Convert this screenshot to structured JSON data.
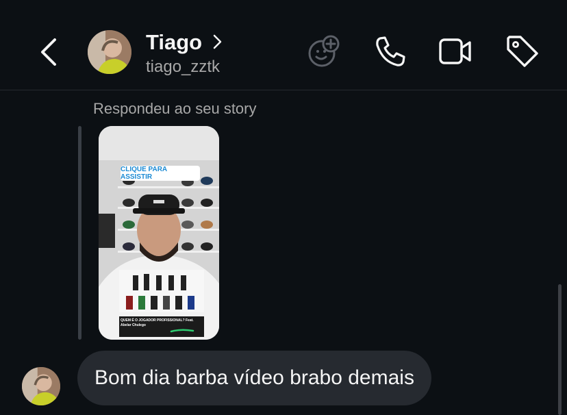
{
  "header": {
    "name": "Tiago",
    "username": "tiago_zztk"
  },
  "icons": {
    "back": "chevron-left-icon",
    "profile_chevron": "chevron-right-icon",
    "effects": "face-plus-icon",
    "call": "phone-icon",
    "video": "video-camera-icon",
    "tag": "tag-icon"
  },
  "thread": {
    "reply_label": "Respondeu ao seu story",
    "story": {
      "link_sticker": "CLIQUE PARA ASSISTIR",
      "caption_title": "QUEM É O JOGADOR PROFISSIONAL? Feat.",
      "caption_sub": "Abelar Chulego"
    },
    "message": "Bom dia barba vídeo brabo demais"
  },
  "colors": {
    "background": "#0c1014",
    "bubble": "#262a30",
    "secondary_text": "#a8a8a8",
    "link_blue": "#1a8ad4"
  }
}
